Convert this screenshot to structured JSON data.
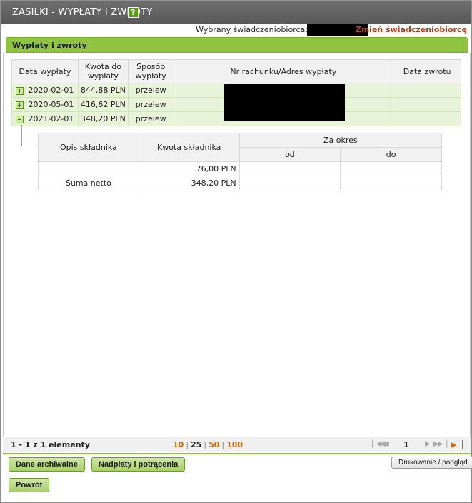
{
  "window": {
    "title": "ZASILKI - WYPŁATY I ZWROTY",
    "help_icon": "?"
  },
  "beneficiary": {
    "label": "Wybrany świadczeniobiorca:",
    "change_link": "Zmień świadczeniobiorcę"
  },
  "panel": {
    "title": "Wypłaty i zwroty"
  },
  "table": {
    "headers": [
      "Data wypłaty",
      "Kwota do wypłaty",
      "Sposób wypłaty",
      "Nr rachunku/Adres wypłaty",
      "Data zwrotu"
    ],
    "rows": [
      {
        "date": "2020-02-01",
        "amount": "844,88 PLN",
        "method": "przelew",
        "expand_icon": "plus"
      },
      {
        "date": "2020-05-01",
        "amount": "416,62 PLN",
        "method": "przelew",
        "expand_icon": "plus"
      },
      {
        "date": "2021-02-01",
        "amount": "348,20 PLN",
        "method": "przelew",
        "expand_icon": "minus"
      }
    ]
  },
  "subtable": {
    "headers": {
      "desc": "Opis składnika",
      "amount": "Kwota składnika",
      "period": "Za okres",
      "from": "od",
      "to": "do"
    },
    "rows": [
      {
        "desc": "",
        "amount": "76,00 PLN",
        "from": "",
        "to": ""
      },
      {
        "desc": "Suma netto",
        "amount": "348,20 PLN",
        "from": "",
        "to": ""
      }
    ]
  },
  "pager": {
    "count": "1 - 1 z 1 elementy",
    "sizes": [
      "10",
      "25",
      "50",
      "100"
    ],
    "active_size": "25",
    "page": "1",
    "nav_icons": [
      "first-page-icon",
      "prev-page-icon",
      "next-page-icon",
      "last-page-icon",
      "last-page-highlight-icon"
    ]
  },
  "buttons": {
    "archive": "Dane archiwalne",
    "overpayments": "Nadpłaty i potrącenia",
    "print": "Drukowanie / podgląd",
    "back": "Powrót"
  },
  "colors": {
    "accent_green": "#8fc340",
    "titlebar": "#575757",
    "link_orange": "#cc6a12",
    "link_red": "#b2421a"
  }
}
